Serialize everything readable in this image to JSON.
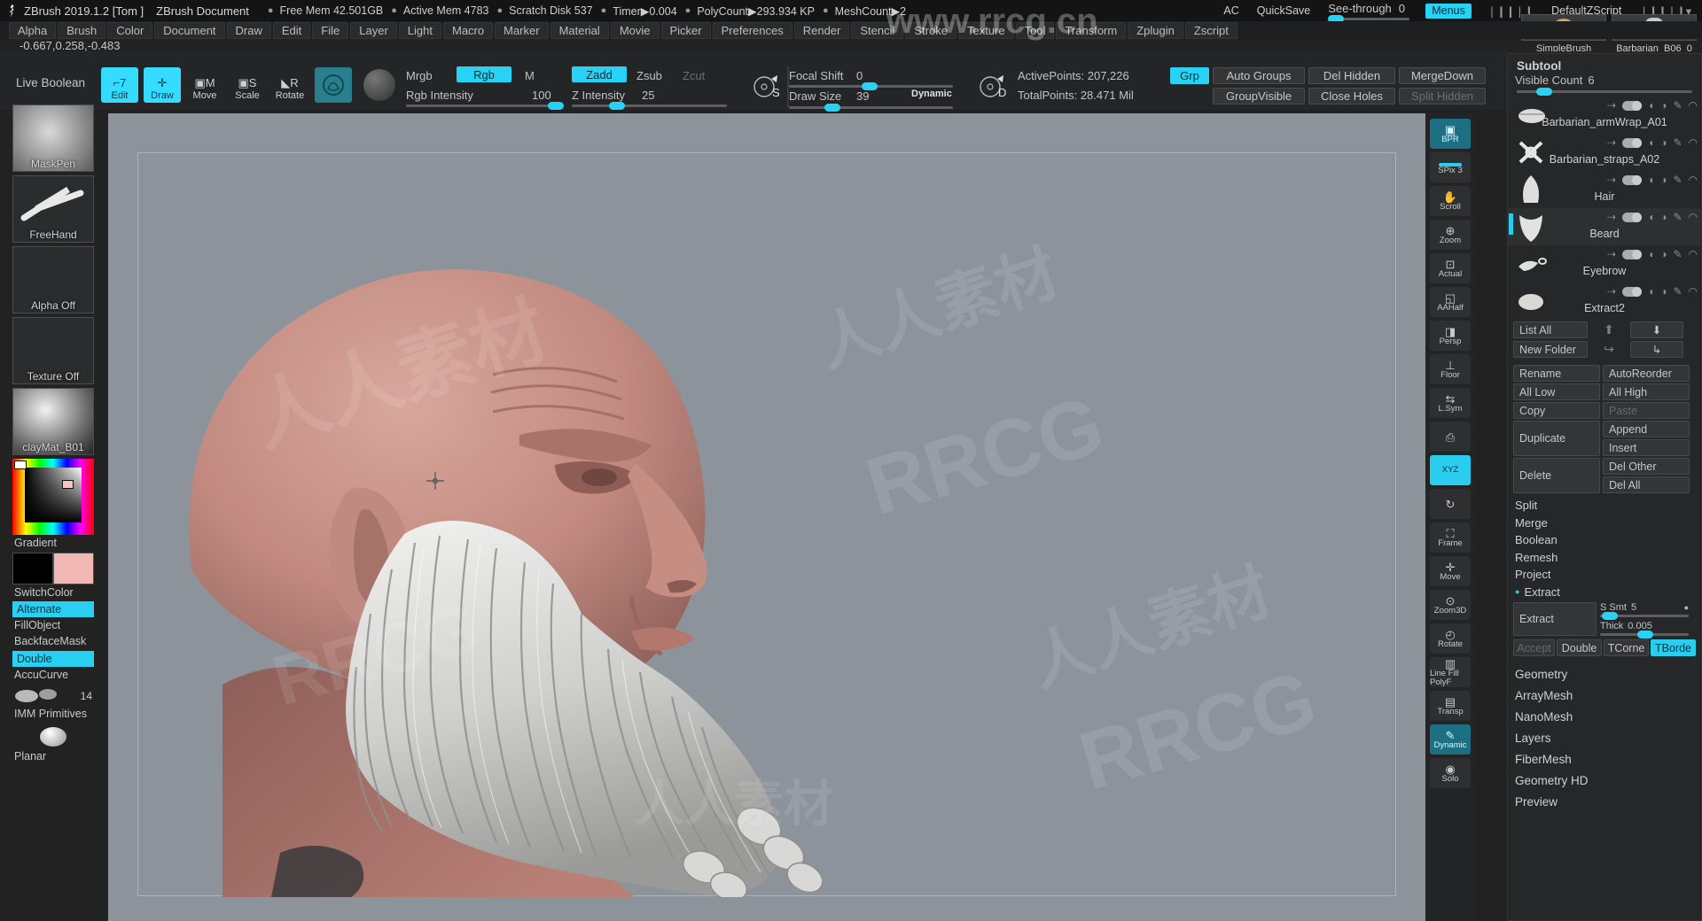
{
  "titlebar": {
    "app": "ZBrush 2019.1.2 [Tom ]",
    "document": "ZBrush Document",
    "stats": [
      "Free Mem 42.501GB",
      "Active Mem 4783",
      "Scratch Disk 537",
      "Timer▶0.004",
      "PolyCount▶293.934 KP",
      "MeshCount▶2"
    ],
    "ac": "AC",
    "quicksave": "QuickSave",
    "seethrough_label": "See-through",
    "seethrough_value": "0",
    "menus": "Menus",
    "default_zscript": "DefaultZScript",
    "tool_a": "SimpleBrush",
    "tool_b": "Barbarian_B06_0"
  },
  "menubar": {
    "items": [
      "Alpha",
      "Brush",
      "Color",
      "Document",
      "Draw",
      "Edit",
      "File",
      "Layer",
      "Light",
      "Macro",
      "Marker",
      "Material",
      "Movie",
      "Picker",
      "Preferences",
      "Render",
      "Stencil",
      "Stroke",
      "Texture",
      "Tool",
      "Transform",
      "Zplugin",
      "Zscript"
    ]
  },
  "coord": "-0.667,0.258,-0.483",
  "toolbar": {
    "live_boolean": "Live Boolean",
    "modes": [
      {
        "label": "Edit",
        "glyph": "⬚",
        "state": "active"
      },
      {
        "label": "Draw",
        "glyph": "✛",
        "state": "active"
      },
      {
        "label": "Move",
        "glyph": "M",
        "state": "idle"
      },
      {
        "label": "Scale",
        "glyph": "S",
        "state": "idle"
      },
      {
        "label": "Rotate",
        "glyph": "R",
        "state": "idle"
      }
    ],
    "mrgb": "Mrgb",
    "rgb": "Rgb",
    "m": "M",
    "zadd": "Zadd",
    "zsub": "Zsub",
    "zcut": "Zcut",
    "rgb_intensity_label": "Rgb Intensity",
    "rgb_intensity_value": "100",
    "z_intensity_label": "Z Intensity",
    "z_intensity_value": "25",
    "focal_shift_label": "Focal Shift",
    "focal_shift_value": "0",
    "draw_size_label": "Draw Size",
    "draw_size_value": "39",
    "dynamic": "Dynamic",
    "active_points": "ActivePoints: 207,226",
    "total_points": "TotalPoints: 28.471 Mil",
    "grp": "Grp",
    "auto_groups": "Auto Groups",
    "group_visible": "GroupVisible",
    "del_hidden": "Del Hidden",
    "close_holes": "Close Holes",
    "merge_down": "MergeDown",
    "split_hidden": "Split Hidden",
    "s_badge": "S",
    "d_badge": "D"
  },
  "left_panel": {
    "brush": "MaskPen",
    "stroke": "FreeHand",
    "alpha": "Alpha Off",
    "texture": "Texture Off",
    "material": "clayMat_B01",
    "gradient": "Gradient",
    "switch_color": "SwitchColor",
    "alternate": "Alternate",
    "fill_object": "FillObject",
    "backface_mask": "BackfaceMask",
    "double": "Double",
    "accu_curve": "AccuCurve",
    "imm_count": "14",
    "imm_primitives": "IMM Primitives",
    "planar": "Planar"
  },
  "right_strip": {
    "items": [
      {
        "label": "BPR",
        "glyph": "▣",
        "state": "on"
      },
      {
        "label": "SPix 3",
        "glyph": "",
        "state": "meter"
      },
      {
        "label": "Scroll",
        "glyph": "✋",
        "state": "off"
      },
      {
        "label": "Zoom",
        "glyph": "⊕",
        "state": "off"
      },
      {
        "label": "Actual",
        "glyph": "⊡",
        "state": "off"
      },
      {
        "label": "AAHalf",
        "glyph": "◱",
        "state": "off"
      },
      {
        "label": "Persp",
        "glyph": "◨",
        "state": "off"
      },
      {
        "label": "Floor",
        "glyph": "⊥",
        "state": "off"
      },
      {
        "label": "L.Sym",
        "glyph": "⇆",
        "state": "off"
      },
      {
        "label": "",
        "glyph": "⎙",
        "state": "off"
      },
      {
        "label": "XYZ",
        "glyph": "",
        "state": "cyan"
      },
      {
        "label": "",
        "glyph": "↻",
        "state": "off"
      },
      {
        "label": "Frame",
        "glyph": "⛶",
        "state": "off"
      },
      {
        "label": "Move",
        "glyph": "✛",
        "state": "off"
      },
      {
        "label": "Zoom3D",
        "glyph": "⊙",
        "state": "off"
      },
      {
        "label": "Rotate",
        "glyph": "◴",
        "state": "off"
      },
      {
        "label": "Line Fill PolyF",
        "glyph": "▥",
        "state": "off"
      },
      {
        "label": "Transp",
        "glyph": "▤",
        "state": "off"
      },
      {
        "label": "Dynamic",
        "glyph": "✎",
        "state": "on"
      },
      {
        "label": "Solo",
        "glyph": "◉",
        "state": "off"
      }
    ],
    "dynamic_sub": "Dynamic"
  },
  "right_panel": {
    "subtool_title": "Subtool",
    "visible_count_label": "Visible Count",
    "visible_count_value": "6",
    "subtools": [
      {
        "name": "Barbarian_armWrap_A01",
        "thumb": "armwrap"
      },
      {
        "name": "Barbarian_straps_A02",
        "thumb": "straps"
      },
      {
        "name": "Hair",
        "thumb": "hair"
      },
      {
        "name": "Beard",
        "thumb": "beard",
        "selected": true
      },
      {
        "name": "Eyebrow",
        "thumb": "eyebrow"
      },
      {
        "name": "Extract2",
        "thumb": "extract"
      }
    ],
    "list_all": "List All",
    "new_folder": "New Folder",
    "rename": "Rename",
    "auto_reorder": "AutoReorder",
    "all_low": "All Low",
    "all_high": "All High",
    "copy": "Copy",
    "paste": "Paste",
    "duplicate": "Duplicate",
    "append": "Append",
    "insert": "Insert",
    "delete": "Delete",
    "del_other": "Del Other",
    "del_all": "Del All",
    "rows": [
      "Split",
      "Merge",
      "Boolean",
      "Remesh",
      "Project"
    ],
    "extract_header": "Extract",
    "extract_button": "Extract",
    "s_smt_label": "S Smt",
    "s_smt_value": "5",
    "thick_label": "Thick",
    "thick_value": "0.005",
    "accept": "Accept",
    "double": "Double",
    "tcorner": "TCorne",
    "tborder": "TBorde",
    "bottom_rows": [
      "Geometry",
      "ArrayMesh",
      "NanoMesh",
      "Layers",
      "FiberMesh",
      "Geometry HD",
      "Preview"
    ]
  },
  "watermarks": {
    "url": "www.rrcg.cn",
    "cn": "人人素材",
    "brand": "RRCG"
  },
  "colors": {
    "accent": "#29cdee",
    "panel": "#262728",
    "canvas": "#8d939b",
    "skin": "#c49289",
    "titlebar": "#141414"
  }
}
